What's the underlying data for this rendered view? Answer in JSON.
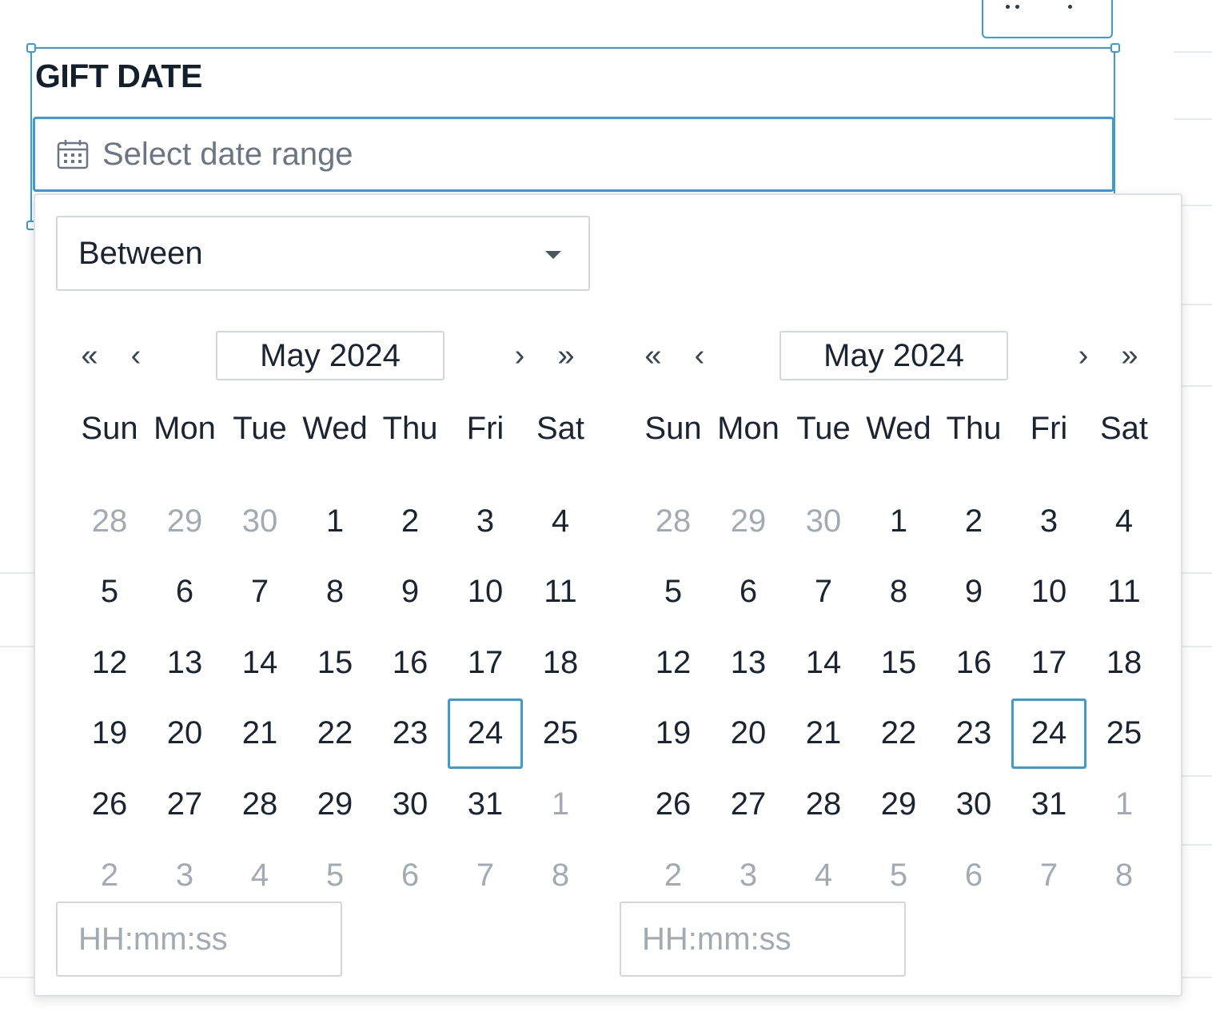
{
  "field": {
    "label": "GIFT DATE",
    "placeholder": "Select date range"
  },
  "toolbar": {
    "icon": "more-dots-icon"
  },
  "filter": {
    "mode": "Between"
  },
  "calendars": [
    {
      "month_label": "May 2024",
      "time_placeholder": "HH:mm:ss"
    },
    {
      "month_label": "May 2024",
      "time_placeholder": "HH:mm:ss"
    }
  ],
  "nav": {
    "prev_year": "«",
    "prev_month": "‹",
    "next_month": "›",
    "next_year": "»"
  },
  "weekdays": [
    "Sun",
    "Mon",
    "Tue",
    "Wed",
    "Thu",
    "Fri",
    "Sat"
  ],
  "days": [
    [
      {
        "d": "28",
        "m": true
      },
      {
        "d": "29",
        "m": true
      },
      {
        "d": "30",
        "m": true
      },
      {
        "d": "1"
      },
      {
        "d": "2"
      },
      {
        "d": "3"
      },
      {
        "d": "4"
      }
    ],
    [
      {
        "d": "5"
      },
      {
        "d": "6"
      },
      {
        "d": "7"
      },
      {
        "d": "8"
      },
      {
        "d": "9"
      },
      {
        "d": "10"
      },
      {
        "d": "11"
      }
    ],
    [
      {
        "d": "12"
      },
      {
        "d": "13"
      },
      {
        "d": "14"
      },
      {
        "d": "15"
      },
      {
        "d": "16"
      },
      {
        "d": "17"
      },
      {
        "d": "18"
      }
    ],
    [
      {
        "d": "19"
      },
      {
        "d": "20"
      },
      {
        "d": "21"
      },
      {
        "d": "22"
      },
      {
        "d": "23"
      },
      {
        "d": "24",
        "today": true
      },
      {
        "d": "25"
      }
    ],
    [
      {
        "d": "26"
      },
      {
        "d": "27"
      },
      {
        "d": "28"
      },
      {
        "d": "29"
      },
      {
        "d": "30"
      },
      {
        "d": "31"
      },
      {
        "d": "1",
        "m": true
      }
    ],
    [
      {
        "d": "2",
        "m": true
      },
      {
        "d": "3",
        "m": true
      },
      {
        "d": "4",
        "m": true
      },
      {
        "d": "5",
        "m": true
      },
      {
        "d": "6",
        "m": true
      },
      {
        "d": "7",
        "m": true
      },
      {
        "d": "8",
        "m": true
      }
    ]
  ],
  "colors": {
    "accent": "#3a9bd5",
    "text": "#1b2430",
    "muted": "#a4aab1"
  }
}
